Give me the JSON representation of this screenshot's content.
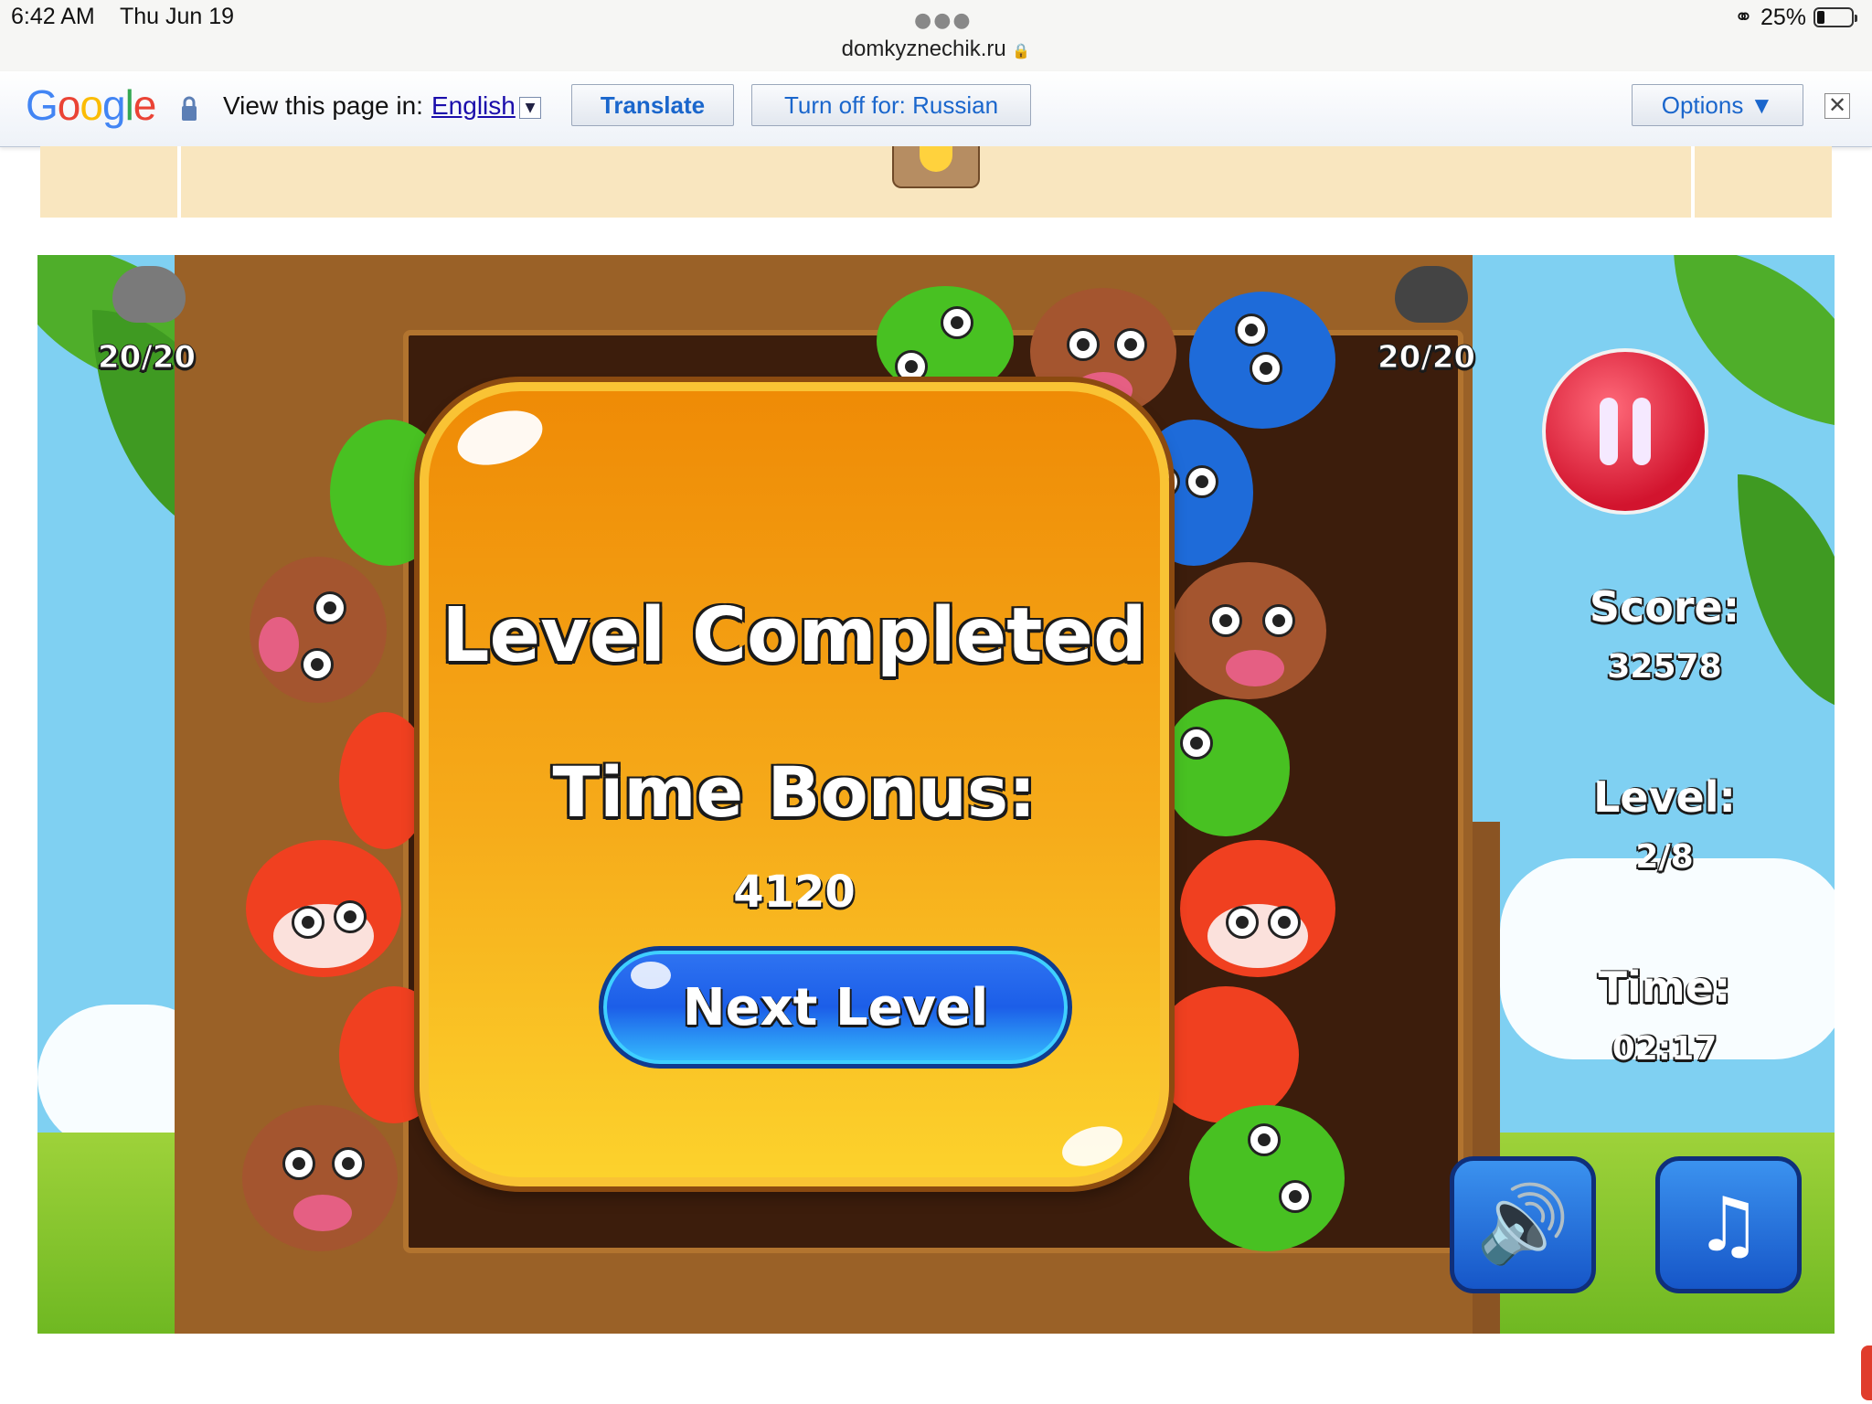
{
  "status_bar": {
    "time": "6:42 AM",
    "date": "Thu Jun 19",
    "battery": "25%",
    "url": "domkyznechik.ru"
  },
  "translate_bar": {
    "view_label": "View this page in:",
    "language": "English",
    "translate_button": "Translate",
    "turn_off_button": "Turn off for: Russian",
    "options_button": "Options ▼",
    "close_symbol": "✕"
  },
  "game": {
    "counter_left": "20/20",
    "counter_right": "20/20",
    "score_label": "Score:",
    "score_value": "32578",
    "level_label": "Level:",
    "level_value": "2/8",
    "time_label": "Time:",
    "time_value": "02:17",
    "dialog": {
      "title": "Level Completed",
      "bonus_label": "Time Bonus:",
      "bonus_value": "4120",
      "next_button": "Next Level"
    },
    "icons": {
      "pause": "pause-icon",
      "sound": "speaker-icon",
      "music": "music-note-icon"
    }
  }
}
